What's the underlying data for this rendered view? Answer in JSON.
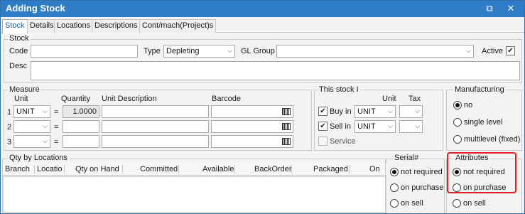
{
  "window": {
    "title": "Adding Stock",
    "restore_glyph": "⧉",
    "close_glyph": "✕"
  },
  "tabs": [
    "Stock",
    "Details",
    "Locations",
    "Descriptions",
    "Cont/mach(Project)s"
  ],
  "stock_group": {
    "label": "Stock",
    "code_label": "Code",
    "code_value": "",
    "type_label": "Type",
    "type_value": "Depleting",
    "gl_label": "GL Group",
    "gl_value": "",
    "active_label": "Active",
    "active_checked": true,
    "desc_label": "Desc",
    "desc_value": ""
  },
  "measure": {
    "label": "Measure",
    "headers": {
      "unit": "Unit",
      "quantity": "Quantity",
      "unit_desc": "Unit Description",
      "barcode": "Barcode"
    },
    "rows": [
      {
        "num": "1",
        "unit": "UNIT",
        "eq": "=",
        "quantity": "1.0000"
      },
      {
        "num": "2",
        "unit": "",
        "eq": "=",
        "quantity": ""
      },
      {
        "num": "3",
        "unit": "",
        "eq": "=",
        "quantity": ""
      }
    ]
  },
  "this_stock": {
    "label": "This stock I",
    "unit_header": "Unit",
    "tax_header": "Tax",
    "buy_label": "Buy in",
    "buy_checked": true,
    "buy_unit": "UNIT",
    "sell_label": "Sell in",
    "sell_checked": true,
    "sell_unit": "UNIT",
    "service_label": "Service",
    "service_checked": false
  },
  "manufacturing": {
    "label": "Manufacturing",
    "options": [
      "no",
      "single level",
      "multilevel (fixed)"
    ],
    "selected": 0
  },
  "qty_by_locations": {
    "label": "Qty by Locations",
    "columns": [
      "Branch",
      "Locatio",
      "Qty on Hand",
      "Committed",
      "Available",
      "BackOrder",
      "Packaged",
      "On"
    ]
  },
  "serial": {
    "label": "Serial#",
    "options": [
      "not required",
      "on purchase",
      "on sell"
    ],
    "selected": 0
  },
  "attributes": {
    "label": "Attributes",
    "options": [
      "not required",
      "on purchase",
      "on sell"
    ],
    "selected": 0
  },
  "colors": {
    "titlebar": "#2e7bc6",
    "highlight": "#e02020",
    "tab_active": "#1f5fa8"
  }
}
